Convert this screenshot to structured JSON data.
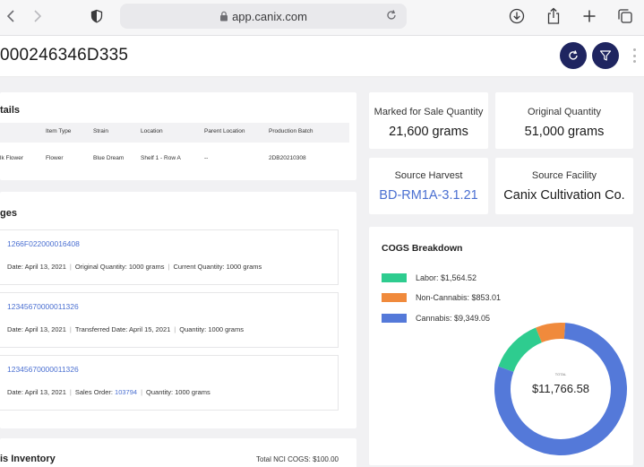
{
  "browser": {
    "url": "app.canix.com"
  },
  "header": {
    "title": "000246346D335"
  },
  "details": {
    "title": "tails",
    "columns": [
      "Item Type",
      "Strain",
      "Location",
      "Parent Location",
      "Production Batch"
    ],
    "row": {
      "category": "lk Flower",
      "item_type": "Flower",
      "strain": "Blue Dream",
      "location": "Shelf 1 - Row A",
      "parent_location": "--",
      "production_batch": "2DB20210308"
    }
  },
  "lineage": {
    "title": "ges",
    "items": [
      {
        "id": "1266F022000016408",
        "meta": [
          "Date: April 13, 2021",
          "Original Quantity: 1000 grams",
          "Current Quantity: 1000 grams"
        ]
      },
      {
        "id": "12345670000011326",
        "meta": [
          "Date: April 13, 2021",
          "Transferred Date: April 15, 2021",
          "Quantity: 1000 grams"
        ]
      },
      {
        "id": "12345670000011326",
        "meta_prefix": "Date: April 13, 2021",
        "sales_order_label": "Sales Order:",
        "sales_order_value": "103794",
        "meta_suffix": "Quantity: 1000 grams"
      }
    ]
  },
  "inventory": {
    "title": "is Inventory",
    "total": "Total NCI COGS: $100.00"
  },
  "stats": {
    "marked_for_sale": {
      "label": "Marked for Sale Quantity",
      "value": "21,600 grams"
    },
    "original": {
      "label": "Original Quantity",
      "value": "51,000 grams"
    },
    "source_harvest": {
      "label": "Source Harvest",
      "value": "BD-RM1A-3.1.21"
    },
    "source_facility": {
      "label": "Source Facility",
      "value": "Canix Cultivation Co."
    }
  },
  "cogs": {
    "title": "COGS Breakdown",
    "legend": [
      {
        "label": "Labor: $1,564.52",
        "color": "#2ecc8f"
      },
      {
        "label": "Non-Cannabis: $853.01",
        "color": "#f08a3c"
      },
      {
        "label": "Cannabis: $9,349.05",
        "color": "#5479d9"
      }
    ],
    "center_label": "TOTAL",
    "center_value": "$11,766.58"
  },
  "chart_data": {
    "type": "pie",
    "categories": [
      "Labor",
      "Non-Cannabis",
      "Cannabis"
    ],
    "values": [
      1564.52,
      853.01,
      9349.05
    ],
    "colors": [
      "#2ecc8f",
      "#f08a3c",
      "#5479d9"
    ],
    "title": "COGS Breakdown",
    "donut": true,
    "legend_placement": "top-left"
  }
}
